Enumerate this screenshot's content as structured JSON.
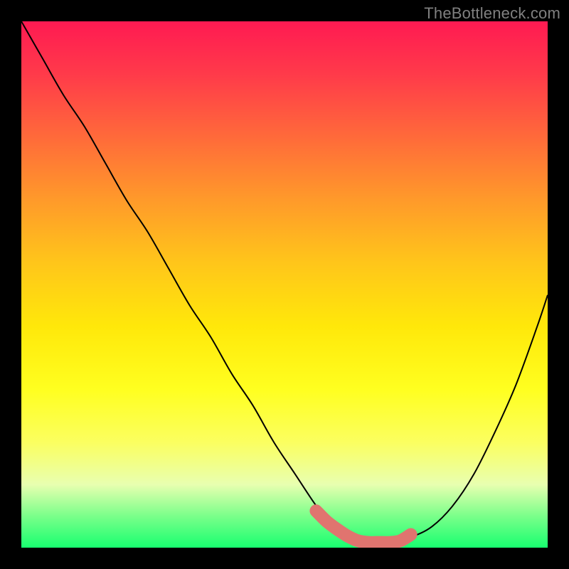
{
  "watermark": "TheBottleneck.com",
  "chart_data": {
    "type": "line",
    "title": "",
    "xlabel": "",
    "ylabel": "",
    "xlim": [
      0,
      100
    ],
    "ylim": [
      0,
      100
    ],
    "series": [
      {
        "name": "bottleneck-curve",
        "x": [
          0,
          4,
          8,
          12,
          16,
          20,
          24,
          28,
          32,
          36,
          40,
          44,
          48,
          52,
          56,
          58,
          60,
          62,
          64,
          66,
          68,
          70,
          74,
          78,
          82,
          86,
          90,
          94,
          98,
          100
        ],
        "y": [
          100,
          93,
          86,
          80,
          73,
          66,
          60,
          53,
          46,
          40,
          33,
          27,
          20,
          14,
          8,
          6,
          4,
          2.5,
          1.5,
          1,
          1,
          1,
          2,
          4,
          8,
          14,
          22,
          31,
          42,
          48
        ]
      }
    ],
    "highlight_band": {
      "name": "optimal-zone",
      "x": [
        56,
        58,
        60,
        62,
        64,
        66,
        68,
        70,
        72,
        74
      ],
      "y": [
        7,
        5,
        3.5,
        2.2,
        1.3,
        1,
        1,
        1,
        1.3,
        2.5
      ],
      "color": "#e0746f"
    }
  }
}
